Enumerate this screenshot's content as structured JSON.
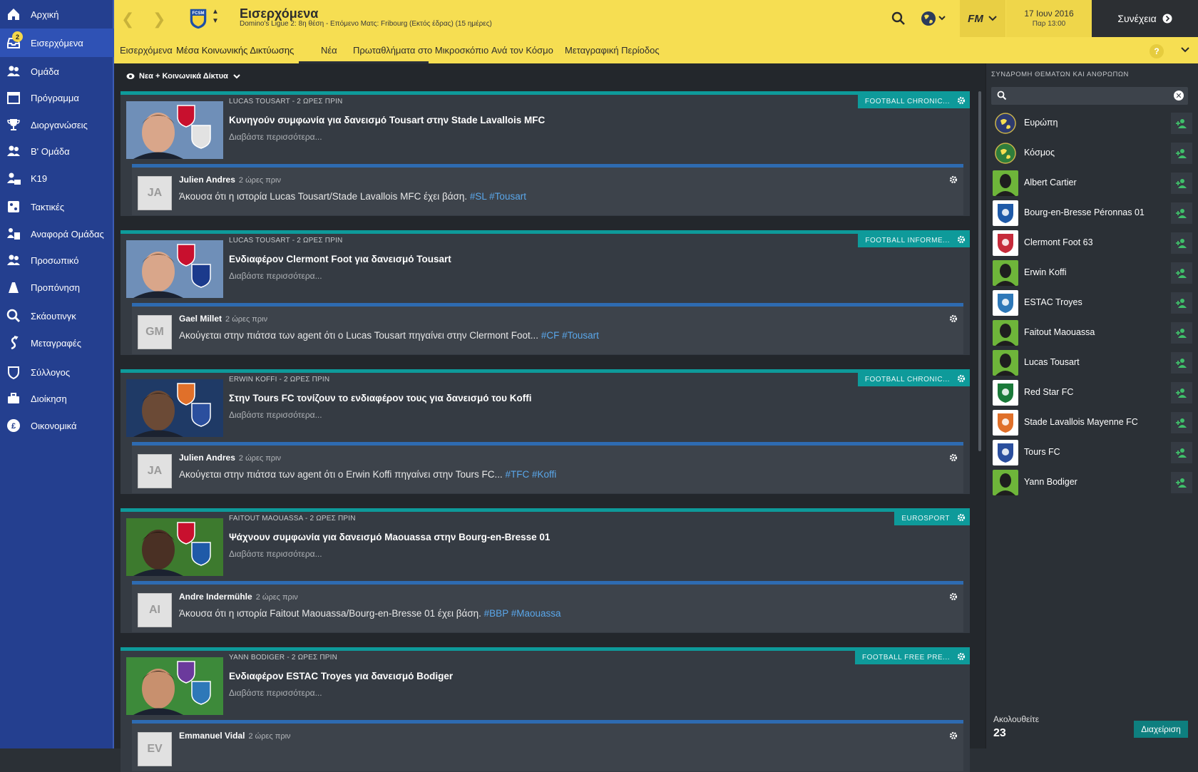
{
  "sidebar": {
    "items": [
      {
        "label": "Αρχική",
        "icon": "home-icon"
      },
      {
        "label": "Εισερχόμενα",
        "icon": "inbox-icon",
        "badge": "2",
        "active": true
      },
      {
        "label": "Ομάδα",
        "icon": "squad-icon"
      },
      {
        "label": "Πρόγραμμα",
        "icon": "calendar-icon"
      },
      {
        "label": "Διοργανώσεις",
        "icon": "trophy-icon"
      },
      {
        "label": "Β' Ομάδα",
        "icon": "reserve-team-icon"
      },
      {
        "label": "Κ19",
        "icon": "u19-icon"
      },
      {
        "label": "Τακτικές",
        "icon": "tactics-icon"
      },
      {
        "label": "Αναφορά Ομάδας",
        "icon": "team-report-icon"
      },
      {
        "label": "Προσωπικό",
        "icon": "staff-icon"
      },
      {
        "label": "Προπόνηση",
        "icon": "training-icon"
      },
      {
        "label": "Σκάουτινγκ",
        "icon": "scouting-icon"
      },
      {
        "label": "Μεταγραφές",
        "icon": "transfers-icon"
      },
      {
        "label": "Σύλλογος",
        "icon": "club-icon"
      },
      {
        "label": "Διοίκηση",
        "icon": "board-icon"
      },
      {
        "label": "Οικονομικά",
        "icon": "finances-icon"
      }
    ]
  },
  "header": {
    "title": "Εισερχόμενα",
    "subtitle": "Domino's Ligue 2: 8η θέση - Επόμενο Ματς: Fribourg (Εκτός έδρας) (15 ημέρες)",
    "date": "17 Ιουν 2016",
    "time": "Παρ 13:00",
    "continue_label": "Συνέχεια",
    "fm_label": "FM"
  },
  "tabs": [
    {
      "label": "Εισερχόμενα"
    },
    {
      "label": "Μέσα Κοινωνικής Δικτύωσης",
      "active": true
    },
    {
      "label": "Νέα"
    },
    {
      "label": "Πρωταθλήματα στο Μικροσκόπιο"
    },
    {
      "label": "Ανά τον Κόσμο"
    },
    {
      "label": "Μεταγραφική Περίοδος"
    }
  ],
  "help_label": "?",
  "feed": {
    "filter_label": "Νεα + Κοινωνικά Δίκτυα",
    "cards": [
      {
        "header": "LUCAS TOUSART - 2 ΩΡΕΣ ΠΡΙΝ",
        "headline": "Κυνηγούν συμφωνία για δανεισμό Tousart στην Stade Lavallois MFC",
        "more": "Διαβάστε περισσότερα...",
        "source": "FOOTBALL CHRONIC...",
        "post": {
          "initials": "JA",
          "author": "Julien Andres",
          "ago": "2 ώρες πριν",
          "text": "Άκουσα ότι η ιστορία Lucas Tousart/Stade Lavallois MFC έχει βάση.",
          "tags": "#SL #Tousart"
        }
      },
      {
        "header": "LUCAS TOUSART - 2 ΩΡΕΣ ΠΡΙΝ",
        "headline": "Ενδιαφέρον Clermont Foot για δανεισμό Tousart",
        "more": "Διαβάστε περισσότερα...",
        "source": "FOOTBALL INFORME...",
        "post": {
          "initials": "GM",
          "author": "Gael Millet",
          "ago": "2 ώρες πριν",
          "text": "Ακούγεται στην πιάτσα των agent ότι ο Lucas Tousart πηγαίνει στην Clermont Foot...",
          "tags": "#CF #Tousart"
        }
      },
      {
        "header": "ERWIN KOFFI - 2 ΩΡΕΣ ΠΡΙΝ",
        "headline": "Στην Tours FC τονίζουν το ενδιαφέρον τους για δανεισμό του Koffi",
        "more": "Διαβάστε περισσότερα...",
        "source": "FOOTBALL CHRONIC...",
        "post": {
          "initials": "JA",
          "author": "Julien Andres",
          "ago": "2 ώρες πριν",
          "text": "Ακούγεται στην πιάτσα των agent ότι ο Erwin Koffi πηγαίνει στην Tours FC...",
          "tags": "#TFC #Koffi"
        }
      },
      {
        "header": "FAITOUT MAOUASSA - 2 ΩΡΕΣ ΠΡΙΝ",
        "headline": "Ψάχνουν συμφωνία για δανεισμό Maouassa στην Bourg-en-Bresse 01",
        "more": "Διαβάστε περισσότερα...",
        "source": "EUROSPORT",
        "post": {
          "initials": "AI",
          "author": "Andre Indermühle",
          "ago": "2 ώρες πριν",
          "text": "Άκουσα ότι η ιστορία Faitout Maouassa/Bourg-en-Bresse 01 έχει βάση.",
          "tags": "#BBP #Maouassa"
        }
      },
      {
        "header": "YANN BODIGER - 2 ΩΡΕΣ ΠΡΙΝ",
        "headline": "Ενδιαφέρον ESTAC Troyes για δανεισμό Bodiger",
        "more": "Διαβάστε περισσότερα...",
        "source": "FOOTBALL FREE PRE...",
        "post": {
          "initials": "EV",
          "author": "Emmanuel Vidal",
          "ago": "2 ώρες πριν",
          "text": "",
          "tags": ""
        }
      }
    ]
  },
  "subscriptions": {
    "title": "ΣΥΝΔΡΟΜΗ ΘΕΜΑΤΩΝ ΚΑΙ ΑΝΘΡΩΠΩΝ",
    "search_placeholder": "",
    "items": [
      {
        "name": "Ευρώπη",
        "type": "region",
        "color": "#2d3a6e"
      },
      {
        "name": "Κόσμος",
        "type": "region",
        "color": "#2f7d3b"
      },
      {
        "name": "Albert Cartier",
        "type": "person",
        "color": "#6eb53a"
      },
      {
        "name": "Bourg-en-Bresse Péronnas 01",
        "type": "club",
        "color": "#1f5aa8"
      },
      {
        "name": "Clermont Foot 63",
        "type": "club",
        "color": "#c62b3b"
      },
      {
        "name": "Erwin Koffi",
        "type": "person",
        "color": "#6eb53a"
      },
      {
        "name": "ESTAC Troyes",
        "type": "club",
        "color": "#2e78b8"
      },
      {
        "name": "Faitout Maouassa",
        "type": "person",
        "color": "#6eb53a"
      },
      {
        "name": "Lucas Tousart",
        "type": "person",
        "color": "#6eb53a"
      },
      {
        "name": "Red Star FC",
        "type": "club",
        "color": "#1b7a3a"
      },
      {
        "name": "Stade Lavallois Mayenne FC",
        "type": "club",
        "color": "#e0702a"
      },
      {
        "name": "Tours FC",
        "type": "club",
        "color": "#2b4f9e"
      },
      {
        "name": "Yann Bodiger",
        "type": "person",
        "color": "#6eb53a"
      }
    ],
    "following_label": "Ακολουθείτε",
    "following_count": "23",
    "manage_label": "Διαχείριση"
  }
}
